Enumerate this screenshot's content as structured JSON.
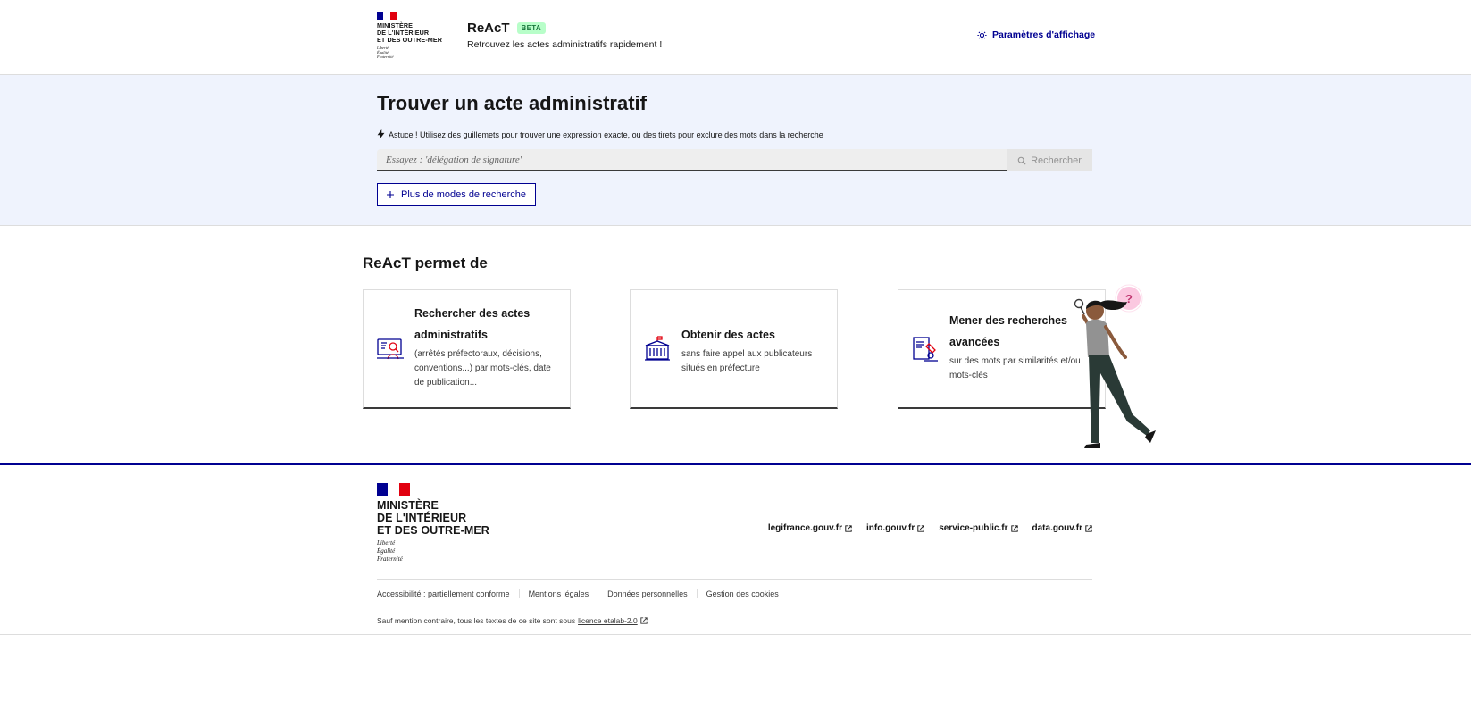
{
  "header": {
    "ministry_lines": [
      "MINISTÈRE",
      "DE L'INTÉRIEUR",
      "ET DES OUTRE-MER"
    ],
    "devise": [
      "Liberté",
      "Égalité",
      "Fraternité"
    ],
    "service_name": "ReAcT",
    "badge": "BETA",
    "tagline": "Retrouvez les actes administratifs rapidement !",
    "display_settings": "Paramètres d'affichage"
  },
  "search": {
    "title": "Trouver un acte administratif",
    "tip": "Astuce ! Utilisez des guillemets pour trouver une expression exacte, ou des tirets pour exclure des mots dans la recherche",
    "placeholder": "Essayez : 'délégation de signature'",
    "button": "Rechercher",
    "more_modes": "Plus de modes de recherche"
  },
  "features": {
    "title": "ReAcT permet de",
    "cards": [
      {
        "title_lines": [
          "Rechercher des actes",
          "administratifs"
        ],
        "description": "(arrêtés préfectoraux, décisions, conventions...) par mots-clés, date de publication...",
        "icon": "search-documents-icon"
      },
      {
        "title_lines": [
          "Obtenir des actes"
        ],
        "description": "sans faire appel aux publicateurs situés en préfecture",
        "icon": "prefecture-building-icon"
      },
      {
        "title_lines": [
          "Mener des recherches",
          "avancées"
        ],
        "description": "sur des mots par similarités et/ou mots-clés",
        "icon": "microscope-document-icon"
      }
    ],
    "illustration_badge": "?"
  },
  "footer": {
    "ministry_lines": [
      "MINISTÈRE",
      "DE L'INTÉRIEUR",
      "ET DES OUTRE-MER"
    ],
    "devise": [
      "Liberté",
      "Égalité",
      "Fraternité"
    ],
    "links": [
      "legifrance.gouv.fr",
      "info.gouv.fr",
      "service-public.fr",
      "data.gouv.fr"
    ],
    "bottom_links": [
      "Accessibilité : partiellement conforme",
      "Mentions légales",
      "Données personnelles",
      "Gestion des cookies"
    ],
    "licence_prefix": "Sauf mention contraire, tous les textes de ce site sont sous",
    "licence_link": "licence etalab-2.0"
  },
  "colors": {
    "primary": "#000091",
    "search_band": "#eff3fd",
    "beta_bg": "#b8fec9",
    "beta_text": "#18753c",
    "marianne_red": "#e1000f"
  }
}
